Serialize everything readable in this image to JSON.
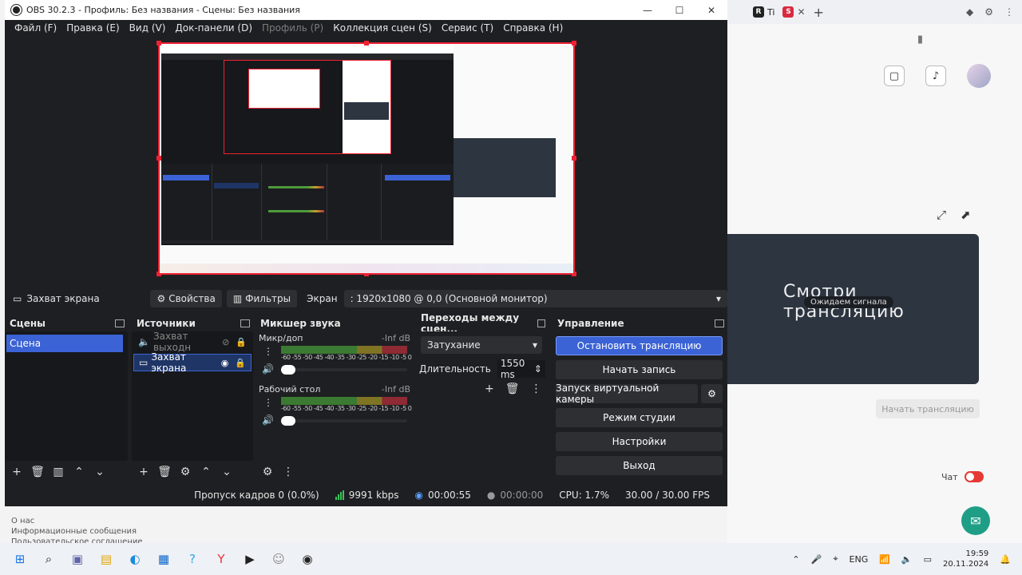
{
  "window": {
    "title": "OBS 30.2.3 - Профиль: Без названия - Сцены: Без названия"
  },
  "menu": [
    "Файл (F)",
    "Правка (E)",
    "Вид (V)",
    "Док-панели (D)",
    "Профиль (P)",
    "Коллекция сцен (S)",
    "Сервис (T)",
    "Справка (H)"
  ],
  "source_bar": {
    "source_name": "Захват экрана",
    "properties_label": "Свойства",
    "filters_label": "Фильтры",
    "screen_label": "Экран",
    "screen_value": ": 1920x1080 @ 0,0 (Основной монитор)"
  },
  "scenes": {
    "title": "Сцены",
    "items": [
      "Сцена"
    ]
  },
  "sources": {
    "title": "Источники",
    "items": [
      {
        "name": "Захват выходн",
        "visible": false
      },
      {
        "name": "Захват экрана",
        "visible": true
      }
    ]
  },
  "mixer": {
    "title": "Микшер звука",
    "channels": [
      {
        "name": "Микр/доп",
        "db": "-Inf dB",
        "scale": "-60 -55 -50 -45 -40 -35 -30 -25 -20 -15 -10 -5 0"
      },
      {
        "name": "Рабочий стол",
        "db": "-Inf dB",
        "scale": "-60 -55 -50 -45 -40 -35 -30 -25 -20 -15 -10 -5 0"
      }
    ]
  },
  "transitions": {
    "title": "Переходы между сцен...",
    "selected": "Затухание",
    "duration_label": "Длительность",
    "duration_value": "1550 ms"
  },
  "controls": {
    "title": "Управление",
    "stop_stream": "Остановить трансляцию",
    "start_record": "Начать запись",
    "virtual_cam": "Запуск виртуальной камеры",
    "studio_mode": "Режим студии",
    "settings": "Настройки",
    "exit": "Выход"
  },
  "status": {
    "dropped": "Пропуск кадров 0 (0.0%)",
    "bitrate": "9991 kbps",
    "stream_time": "00:00:55",
    "record_time": "00:00:00",
    "cpu": "CPU: 1.7%",
    "fps": "30.00 / 30.00 FPS"
  },
  "browser": {
    "tab1": "Ti",
    "player_title": "Смотри трансляцию",
    "player_badge": "Ожидаем сигнала",
    "start_button": "Начать трансляцию",
    "chat_label": "Чат"
  },
  "under_text": [
    "О нас",
    "Информационные сообщения",
    "Пользовательское соглашение"
  ],
  "taskbar": {
    "lang": "ENG",
    "time": "19:59",
    "date": "20.11.2024"
  },
  "colors": {
    "accent": "#3b63d6",
    "obs_bg": "#1e1f22",
    "dock_bg": "#17181b",
    "selection_red": "#e22233"
  }
}
